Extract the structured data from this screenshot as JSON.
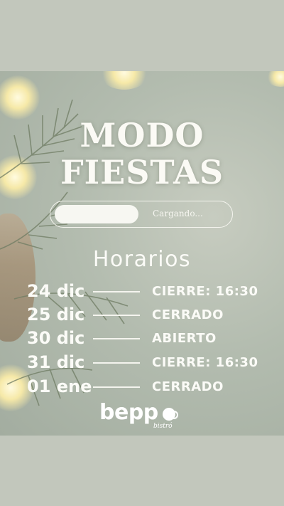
{
  "poster": {
    "title_line1": "MODO",
    "title_line2": "FIESTAS",
    "loader": {
      "text": "Cargando...",
      "progress": 0.48
    },
    "schedule_heading": "Horarios",
    "schedule": [
      {
        "date": "24 dic",
        "status": "CIERRE: 16:30"
      },
      {
        "date": "25 dic",
        "status": "CERRADO"
      },
      {
        "date": "30 dic",
        "status": "ABIERTO"
      },
      {
        "date": "31 dic",
        "status": "CIERRE: 16:30"
      },
      {
        "date": "01 ene",
        "status": "CERRADO"
      }
    ],
    "logo": {
      "word": "bepp",
      "sub": "bistró"
    }
  },
  "colors": {
    "frame": "#c2c7bc",
    "poster_bg": "#b3bcaf",
    "text": "#fbfbf7",
    "light": "#f6e9a8"
  }
}
